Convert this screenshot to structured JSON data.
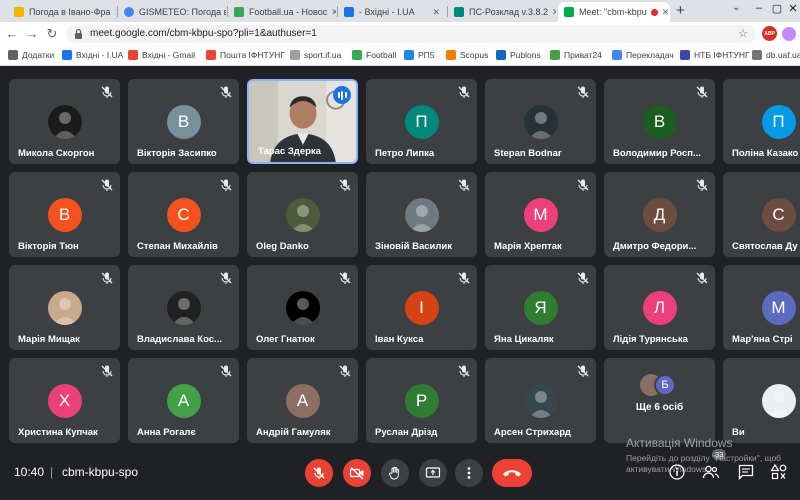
{
  "browser": {
    "tabs": [
      {
        "title": "Погода в Івано-Фра",
        "favicon_color": "#f4b400"
      },
      {
        "title": "GISMETEO: Погода в",
        "favicon_color": "#4285f4"
      },
      {
        "title": "Football.ua - Новос",
        "favicon_color": "#34a853"
      },
      {
        "title": "- Вхідні - I.UA",
        "favicon_color": "#1a73e8"
      },
      {
        "title": "ПС-Розклад v.3.8.2",
        "favicon_color": "#00897b"
      },
      {
        "title": "Meet: \"cbm-kbpu",
        "favicon_color": "#00ac47"
      }
    ],
    "url": "meet.google.com/cbm-kbpu-spo?pli=1&authuser=1",
    "adblock_label": "ABP",
    "bookmarks": [
      {
        "label": "Додатки",
        "color": "#5f6368"
      },
      {
        "label": "Вхідні - I.UA",
        "color": "#1a73e8"
      },
      {
        "label": "Вхідні - Gmail",
        "color": "#ea4335"
      },
      {
        "label": "Пошта ІФНТУНГ",
        "color": "#ea4335"
      },
      {
        "label": "sport.if.ua",
        "color": "#9aa0a6"
      },
      {
        "label": "Football",
        "color": "#34a853"
      },
      {
        "label": "РП5",
        "color": "#1e88e5"
      },
      {
        "label": "Scopus",
        "color": "#f57c00"
      },
      {
        "label": "Publons",
        "color": "#1565c0"
      },
      {
        "label": "Приват24",
        "color": "#43a047"
      },
      {
        "label": "Перекладач",
        "color": "#4285f4"
      },
      {
        "label": "НТБ ІФНТУНГ",
        "color": "#3949ab"
      },
      {
        "label": "db.uaf.ua",
        "color": "#757575"
      }
    ]
  },
  "participants": [
    {
      "name": "Микола Скоргон",
      "initial": "",
      "color": "#1b1b1b",
      "type": "photo"
    },
    {
      "name": "Вікторія Засипко",
      "initial": "В",
      "color": "#78909c",
      "type": "letter"
    },
    {
      "name": "Тарас Здерка",
      "initial": "",
      "color": "#7f8b8e",
      "type": "video"
    },
    {
      "name": "Петро Липка",
      "initial": "П",
      "color": "#00897b",
      "type": "letter"
    },
    {
      "name": "Stepan Bodnar",
      "initial": "",
      "color": "#263238",
      "type": "photo"
    },
    {
      "name": "Володимир Росп...",
      "initial": "В",
      "color": "#1b5e20",
      "type": "letter"
    },
    {
      "name": "Поліна Казако",
      "initial": "П",
      "color": "#039be5",
      "type": "letter"
    },
    {
      "name": "Вікторія Тюн",
      "initial": "В",
      "color": "#f4511e",
      "type": "letter"
    },
    {
      "name": "Степан Михайлів",
      "initial": "С",
      "color": "#f4511e",
      "type": "letter"
    },
    {
      "name": "Oleg Danko",
      "initial": "",
      "color": "#4e5b3a",
      "type": "photo"
    },
    {
      "name": "Зіновій Василик",
      "initial": "",
      "color": "#6d7a80",
      "type": "photo"
    },
    {
      "name": "Марія Хрептак",
      "initial": "М",
      "color": "#ec407a",
      "type": "letter"
    },
    {
      "name": "Дмитро Федори...",
      "initial": "Д",
      "color": "#6d4c41",
      "type": "letter"
    },
    {
      "name": "Святослав Ду",
      "initial": "С",
      "color": "#6d4c41",
      "type": "letter"
    },
    {
      "name": "Марія Мищак",
      "initial": "",
      "color": "#c8a98a",
      "type": "photo"
    },
    {
      "name": "Владислава Кос...",
      "initial": "",
      "color": "#212121",
      "type": "photo"
    },
    {
      "name": "Олег Гнатюк",
      "initial": "",
      "color": "#000000",
      "type": "photo"
    },
    {
      "name": "Іван Кукса",
      "initial": "І",
      "color": "#d84315",
      "type": "letter"
    },
    {
      "name": "Яна Цикаляк",
      "initial": "Я",
      "color": "#2e7d32",
      "type": "letter"
    },
    {
      "name": "Лідія Турянська",
      "initial": "Л",
      "color": "#ec407a",
      "type": "letter"
    },
    {
      "name": "Мар'яна Стрі",
      "initial": "М",
      "color": "#5c6bc0",
      "type": "letter"
    },
    {
      "name": "Христина Купчак",
      "initial": "Х",
      "color": "#ec407a",
      "type": "letter"
    },
    {
      "name": "Анна Рогалє",
      "initial": "А",
      "color": "#43a047",
      "type": "letter"
    },
    {
      "name": "Андрій Гамуляк",
      "initial": "А",
      "color": "#8d6e63",
      "type": "letter"
    },
    {
      "name": "Руслан Дрізд",
      "initial": "Р",
      "color": "#2e7d32",
      "type": "letter"
    },
    {
      "name": "Арсен Стрихард",
      "initial": "",
      "color": "#37474f",
      "type": "photo"
    },
    {
      "name": "",
      "initial": "Б",
      "color": "#5c6bc0",
      "type": "more"
    },
    {
      "name": "Ви",
      "initial": "",
      "color": "#eceff1",
      "type": "photo"
    }
  ],
  "more_tile": {
    "label": "Ще 6 осіб"
  },
  "bottom": {
    "time": "10:40",
    "divider": "|",
    "meeting_code": "cbm-kbpu-spo",
    "participant_count": "33"
  },
  "watermark": {
    "title": "Активація Windows",
    "line1": "Перейдіть до розділу \"Настройки\", щоб",
    "line2": "активувати Windows."
  }
}
